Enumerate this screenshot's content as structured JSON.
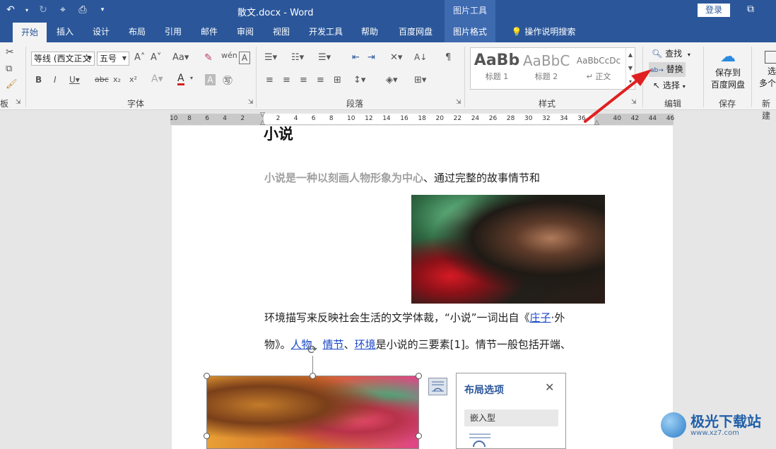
{
  "titlebar": {
    "doc_title": "散文.docx  -  Word",
    "context_title": "图片工具",
    "login": "登录"
  },
  "tabs": [
    {
      "label": "开始",
      "active": true
    },
    {
      "label": "插入"
    },
    {
      "label": "设计"
    },
    {
      "label": "布局"
    },
    {
      "label": "引用"
    },
    {
      "label": "邮件"
    },
    {
      "label": "审阅"
    },
    {
      "label": "视图"
    },
    {
      "label": "开发工具"
    },
    {
      "label": "帮助"
    },
    {
      "label": "百度网盘"
    },
    {
      "label": "图片格式",
      "context": true
    },
    {
      "label": "操作说明搜索"
    }
  ],
  "ribbon": {
    "font_name": "等线 (西文正文",
    "font_size": "五号",
    "group_font": "字体",
    "group_paragraph": "段落",
    "group_styles": "样式",
    "group_edit": "编辑",
    "group_save": "保存",
    "group_new": "新建",
    "group_clipboard_tail": "板",
    "styles": [
      {
        "sample": "AaBb",
        "name": "标题 1"
      },
      {
        "sample": "AaBbC",
        "name": "标题 2"
      },
      {
        "sample": "AaBbCcDc",
        "name": "↵ 正文"
      }
    ],
    "find": "查找",
    "replace": "替换",
    "select": "选择",
    "save_to": "保存到",
    "baidu": "百度网盘",
    "select_multi_1": "选",
    "select_multi_2": "多个"
  },
  "ruler": [
    "10",
    "8",
    "6",
    "4",
    "2",
    "",
    "2",
    "4",
    "6",
    "8",
    "10",
    "12",
    "14",
    "16",
    "18",
    "20",
    "22",
    "24",
    "26",
    "28",
    "30",
    "32",
    "34",
    "36",
    "",
    "40",
    "42",
    "44",
    "46"
  ],
  "document": {
    "heading": "小说",
    "line1_bold": "小说是一种以刻画人物形象为中心",
    "line1_rest": "、通过完整的故事情节和",
    "line2": "环境描写来反映社会生活的文学体裁，“小说”一词出自《",
    "line2_link": "庄子",
    "line2_end": "·外",
    "line3_start": "物》。",
    "line3_link1": "人物",
    "line3_sep1": "、",
    "line3_link2": "情节",
    "line3_sep2": "、",
    "line3_link3": "环境",
    "line3_end": "是小说的三要素[1]。情节一般包括开端、"
  },
  "layout_panel": {
    "title": "布局选项",
    "section": "嵌入型"
  },
  "watermark": {
    "title": "极光下载站",
    "url": "www.xz7.com"
  },
  "colors": {
    "accent": "#2b579a",
    "arrow": "#e02020",
    "link": "#1a47c8"
  }
}
